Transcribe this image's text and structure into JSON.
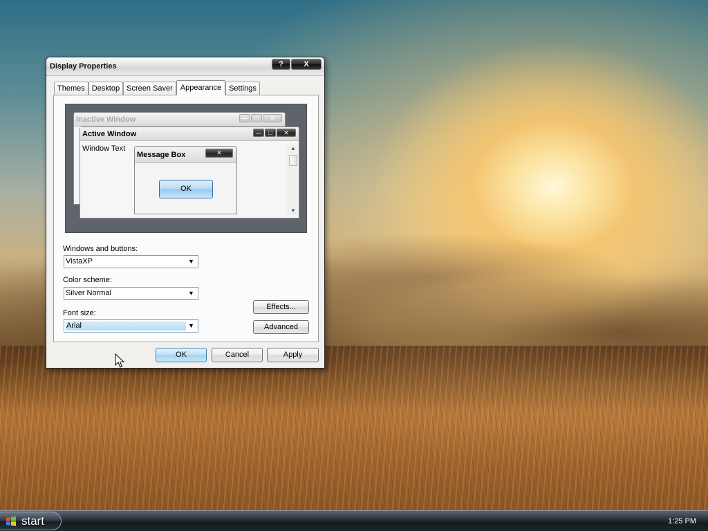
{
  "window": {
    "title": "Display Properties",
    "help_button": "?",
    "close_button": "X"
  },
  "tabs": [
    {
      "label": "Themes",
      "active": false
    },
    {
      "label": "Desktop",
      "active": false
    },
    {
      "label": "Screen Saver",
      "active": false
    },
    {
      "label": "Appearance",
      "active": true
    },
    {
      "label": "Settings",
      "active": false
    }
  ],
  "preview": {
    "inactive_title": "Inactive Window",
    "active_title": "Active Window",
    "window_text": "Window Text",
    "message_box_title": "Message Box",
    "ok_label": "OK"
  },
  "form": {
    "windows_buttons_label": "Windows and buttons:",
    "windows_buttons_value": "VistaXP",
    "color_scheme_label": "Color scheme:",
    "color_scheme_value": "Silver Normal",
    "font_size_label": "Font size:",
    "font_size_value": "Arial",
    "effects_label": "Effects...",
    "advanced_label": "Advanced"
  },
  "footer": {
    "ok_label": "OK",
    "cancel_label": "Cancel",
    "apply_label": "Apply"
  },
  "taskbar": {
    "start_label": "start",
    "clock": "1:25 PM"
  },
  "colors": {
    "accent_blue": "#b9ddf5",
    "taskbar_dark": "#1f252d",
    "title_button_black": "#262626"
  }
}
